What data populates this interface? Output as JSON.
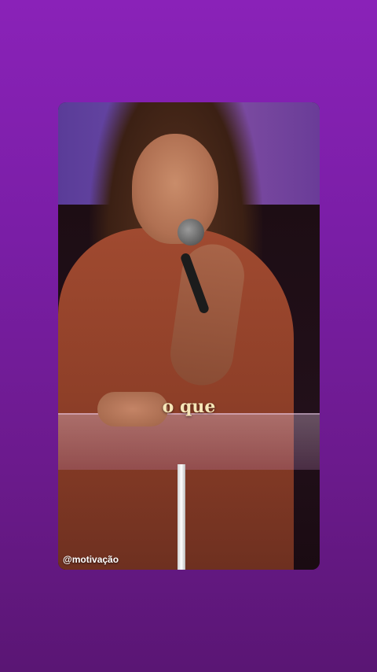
{
  "video": {
    "caption": "o que",
    "watermark": "@motivação"
  },
  "colors": {
    "background": "#7a1ea6",
    "caption": "#f6e6b8",
    "watermark": "#ffffff"
  }
}
